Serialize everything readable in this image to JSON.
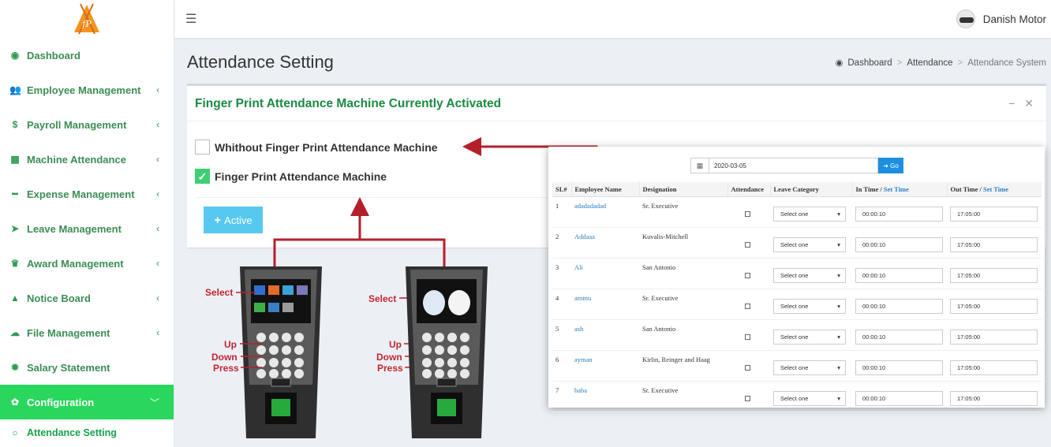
{
  "app": {
    "user_name": "Danish Motor"
  },
  "sidebar": {
    "items": [
      {
        "label": "Dashboard",
        "icon": "dashboard-icon",
        "glyph": "◉",
        "has_children": false
      },
      {
        "label": "Employee Management",
        "icon": "users-icon",
        "glyph": "👥",
        "has_children": true
      },
      {
        "label": "Payroll Management",
        "icon": "dollar-icon",
        "glyph": "$",
        "has_children": true
      },
      {
        "label": "Machine Attendance",
        "icon": "calendar-icon",
        "glyph": "▦",
        "has_children": true
      },
      {
        "label": "Expense Management",
        "icon": "minus-icon",
        "glyph": "━",
        "has_children": true
      },
      {
        "label": "Leave Management",
        "icon": "plane-icon",
        "glyph": "➤",
        "has_children": true
      },
      {
        "label": "Award Management",
        "icon": "trophy-icon",
        "glyph": "♛",
        "has_children": true
      },
      {
        "label": "Notice Board",
        "icon": "bell-icon",
        "glyph": "▲",
        "has_children": true
      },
      {
        "label": "File Management",
        "icon": "cloud-icon",
        "glyph": "☁",
        "has_children": true
      },
      {
        "label": "Salary Statement",
        "icon": "gear-icon",
        "glyph": "✹",
        "has_children": false
      },
      {
        "label": "Configuration",
        "icon": "cog-icon",
        "glyph": "✿",
        "has_children": true,
        "active": true
      }
    ],
    "sub_item": {
      "label": "Attendance Setting",
      "icon": "circle-icon",
      "glyph": "○"
    }
  },
  "header": {
    "menu_icon": "hamburger-icon"
  },
  "page": {
    "title": "Attendance Setting"
  },
  "breadcrumb": {
    "home": "Dashboard",
    "section": "Attendance",
    "current": "Attendance System"
  },
  "panel": {
    "title": "Finger Print Attendance Machine Currently Activated",
    "option_without": "Whithout Finger Print Attendance Machine",
    "option_with": "Finger Print Attendance Machine",
    "active_button": "Active"
  },
  "device_labels": {
    "select": "Select",
    "up": "Up",
    "down": "Down",
    "press": "Press"
  },
  "attendance_table": {
    "date": "2020-03-05",
    "go_label": "Go",
    "headers": {
      "sl": "SL#",
      "employee": "Employee Name",
      "designation": "Designation",
      "attendance": "Attendance",
      "leave": "Leave Category",
      "in_time": "In Time /",
      "out_time": "Out Time /",
      "set_time": "Set Time"
    },
    "rows": [
      {
        "sl": "1",
        "name": "adadadadad",
        "designation": "Sr. Executive",
        "leave": "Select one",
        "in": "00:00:10",
        "out": "17:05:00"
      },
      {
        "sl": "2",
        "name": "Addaaa",
        "designation": "Kuvalis-Mitchell",
        "leave": "Select one",
        "in": "00:00:10",
        "out": "17:05:00"
      },
      {
        "sl": "3",
        "name": "Ali",
        "designation": "San Antonio",
        "leave": "Select one",
        "in": "00:00:10",
        "out": "17:05:00"
      },
      {
        "sl": "4",
        "name": "ammu",
        "designation": "Sr. Executive",
        "leave": "Select one",
        "in": "00:00:10",
        "out": "17:05:00"
      },
      {
        "sl": "5",
        "name": "ash",
        "designation": "San Antonio",
        "leave": "Select one",
        "in": "00:00:10",
        "out": "17:05:00"
      },
      {
        "sl": "6",
        "name": "ayman",
        "designation": "Kirlin, Reinger and Haag",
        "leave": "Select one",
        "in": "00:00:10",
        "out": "17:05:00"
      },
      {
        "sl": "7",
        "name": "baba",
        "designation": "Sr. Executive",
        "leave": "Select one",
        "in": "00:00:10",
        "out": "17:05:00"
      }
    ]
  },
  "colors": {
    "brand_green": "#1a8a43",
    "active_menu": "#28d75c",
    "arrow_red": "#b3202b",
    "button_blue": "#57c8f0",
    "link_blue": "#2a80c7",
    "logo_orange": "#f39321"
  }
}
